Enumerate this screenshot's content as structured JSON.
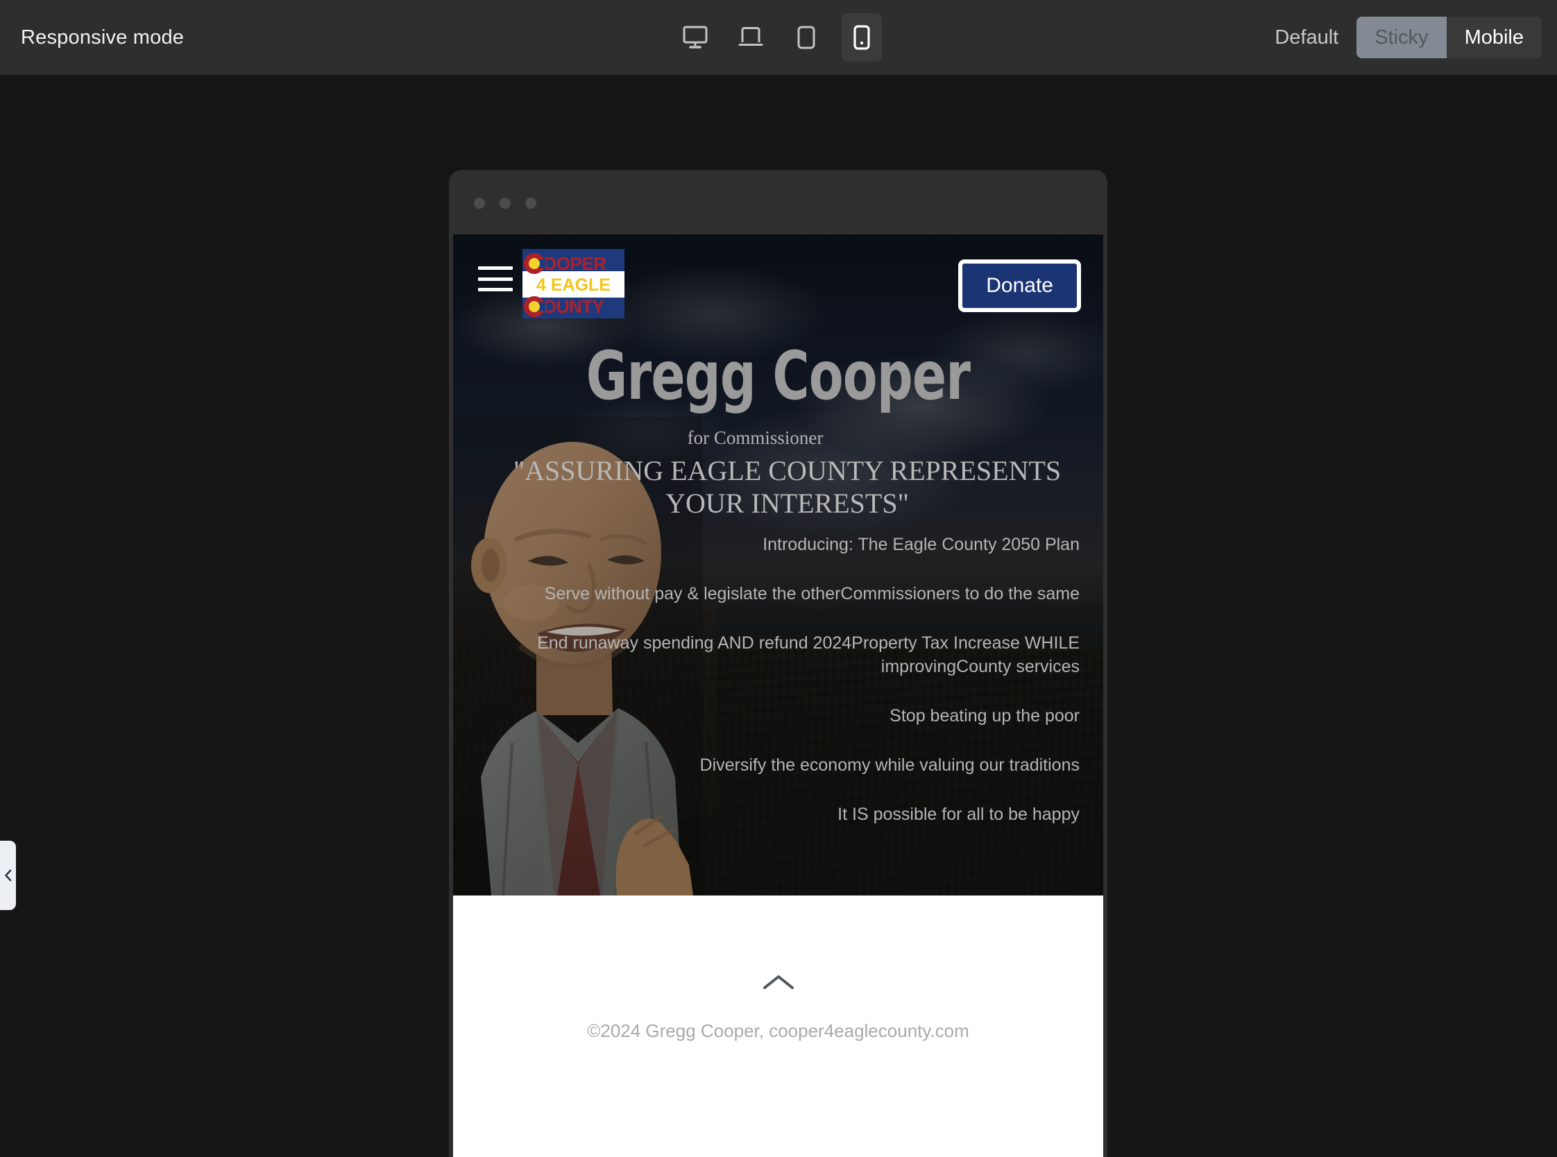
{
  "toolbar": {
    "title": "Responsive mode",
    "devices": [
      {
        "name": "desktop",
        "label": "Desktop",
        "active": false
      },
      {
        "name": "laptop",
        "label": "Laptop",
        "active": false
      },
      {
        "name": "tablet",
        "label": "Tablet",
        "active": false
      },
      {
        "name": "mobile",
        "label": "Mobile",
        "active": true
      }
    ],
    "modes": {
      "default_label": "Default",
      "sticky_label": "Sticky",
      "mobile_label": "Mobile"
    }
  },
  "edge_tab": {
    "icon": "chevron-left-icon"
  },
  "browser": {
    "dots": 3
  },
  "site": {
    "header": {
      "menu_icon": "hamburger-menu-icon",
      "logo": {
        "line1": "OOPER",
        "line2": "4 EAGLE",
        "line3": "OUNTY",
        "colors": {
          "field": "#1e3a7d",
          "stripe": "#ffffff",
          "letter_red": "#b02028",
          "letter_yellow": "#f5c518",
          "disc_yellow": "#f5d130"
        }
      },
      "donate_label": "Donate",
      "donate_colors": {
        "fill": "#1b3473",
        "border": "#ffffff",
        "text": "#ffffff"
      }
    },
    "hero": {
      "name": "Gregg Cooper",
      "subtitle": "for Commissioner",
      "quote": "\"ASSURING EAGLE COUNTY REPRESENTS YOUR INTERESTS\"",
      "points": [
        "Introducing: The Eagle County 2050 Plan",
        "Serve without pay & legislate the otherCommissioners to do the same",
        "End runaway spending AND refund 2024Property Tax Increase WHILE improvingCounty services",
        "Stop beating up the poor",
        "Diversify the economy while valuing our traditions",
        "It IS possible for all to be happy"
      ]
    },
    "footer": {
      "scroll_top_icon": "chevron-up-icon",
      "copyright": "©2024 Gregg Cooper, cooper4eaglecounty.com"
    }
  }
}
